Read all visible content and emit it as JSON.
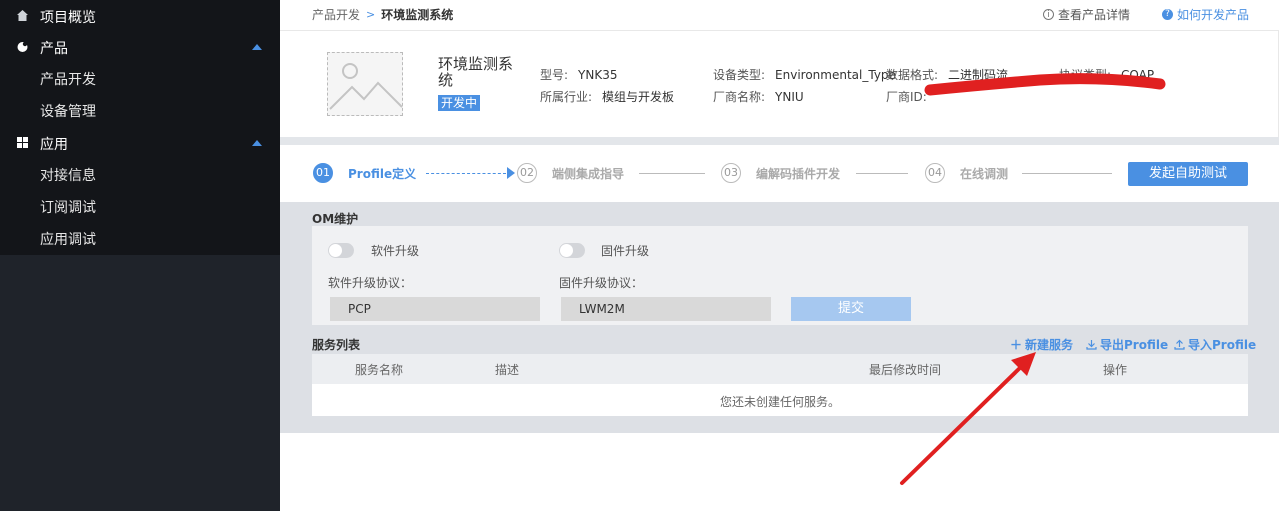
{
  "sidebar": {
    "project_overview": "项目概览",
    "product_group": "产品",
    "product_dev": "产品开发",
    "device_mgmt": "设备管理",
    "app_group": "应用",
    "integration_info": "对接信息",
    "subscribe_debug": "订阅调试",
    "app_debug": "应用调试"
  },
  "breadcrumb": {
    "parent": "产品开发",
    "separator": ">",
    "current": "环境监测系统"
  },
  "top_links": {
    "detail": "查看产品详情",
    "how_to": "如何开发产品"
  },
  "product": {
    "name": "环境监测系统",
    "status": "开发中",
    "model_label": "型号:",
    "model": "YNK35",
    "industry_label": "所属行业:",
    "industry": "模组与开发板",
    "device_type_label": "设备类型:",
    "device_type": "Environmental_Type",
    "vendor_label": "厂商名称:",
    "vendor": "YNIU",
    "data_format_label": "数据格式:",
    "data_format": "二进制码流",
    "vendor_id_label": "厂商ID:",
    "protocol_label": "协议类型:",
    "protocol": "COAP"
  },
  "steps": [
    {
      "num": "01",
      "label": "Profile定义"
    },
    {
      "num": "02",
      "label": "端侧集成指导"
    },
    {
      "num": "03",
      "label": "编解码插件开发"
    },
    {
      "num": "04",
      "label": "在线调测"
    }
  ],
  "test_button": "发起自助测试",
  "om": {
    "title": "OM维护",
    "software_upgrade": "软件升级",
    "firmware_upgrade": "固件升级",
    "software_protocol_label": "软件升级协议：",
    "firmware_protocol_label": "固件升级协议：",
    "software_protocol": "PCP",
    "firmware_protocol": "LWM2M",
    "submit": "提交"
  },
  "services": {
    "title": "服务列表",
    "new_service": "新建服务",
    "export_profile": "导出Profile",
    "import_profile": "导入Profile",
    "columns": [
      "服务名称",
      "描述",
      "最后修改时间",
      "操作"
    ],
    "empty": "您还未创建任何服务。"
  },
  "colors": {
    "accent": "#4a90e2",
    "sidebar_bg": "#1f232a",
    "annotation_red": "#e02020"
  }
}
